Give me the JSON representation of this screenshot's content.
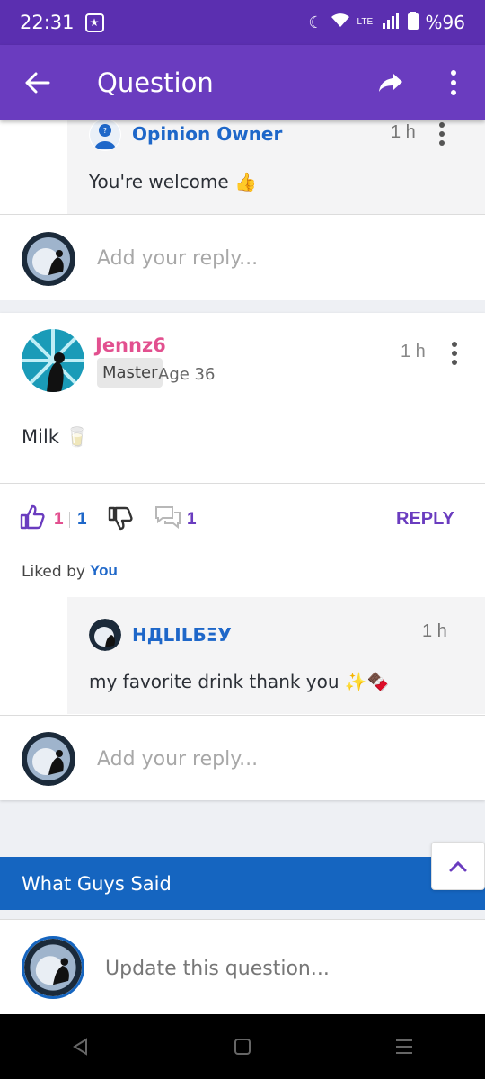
{
  "status_bar": {
    "time": "22:31",
    "battery": "%96",
    "network": "LTE"
  },
  "app_bar": {
    "title": "Question",
    "back_icon": "arrow-left-icon",
    "share_icon": "share-icon",
    "more_icon": "more-vertical-icon"
  },
  "top_reply": {
    "author": "Opinion Owner",
    "time": "1 h",
    "text": "You're welcome 👍"
  },
  "add_reply_placeholder": "Add your reply...",
  "comment": {
    "author": "Jennz6",
    "badge": "Master",
    "age": "Age 36",
    "time": "1 h",
    "text": "Milk 🥛",
    "likes": "1",
    "likes_total": "1",
    "replies_count": "1",
    "reply_label": "REPLY",
    "liked_by_label": "Liked by",
    "liked_by_user": "You",
    "author_color": "#e2508f"
  },
  "nested_reply": {
    "author": "НДLILБΞУ",
    "time": "1 h",
    "text": "my favorite drink thank you ✨🍫"
  },
  "section_header": {
    "label": "What Guys Said",
    "color": "#1565c0"
  },
  "update_question": {
    "placeholder": "Update this question..."
  },
  "colors": {
    "primary": "#6a3cbf",
    "status_bar": "#5b2fb0",
    "link": "#1e67c9"
  }
}
